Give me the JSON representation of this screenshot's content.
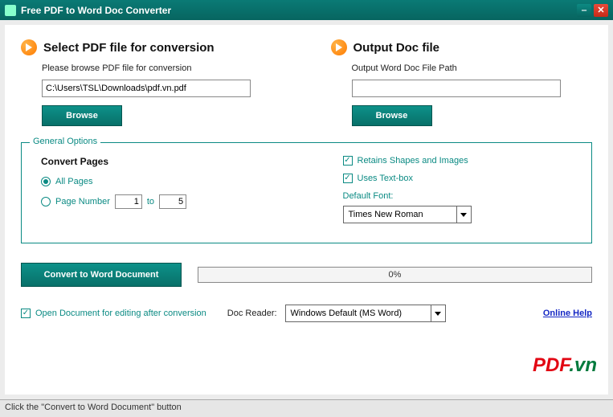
{
  "window": {
    "title": "Free PDF to Word Doc Converter"
  },
  "input_panel": {
    "heading": "Select PDF file for conversion",
    "sub": "Please browse PDF file for conversion",
    "path": "C:\\Users\\TSL\\Downloads\\pdf.vn.pdf",
    "browse": "Browse"
  },
  "output_panel": {
    "heading": "Output Doc file",
    "sub": "Output Word Doc File Path",
    "path": "",
    "browse": "Browse"
  },
  "options": {
    "legend": "General Options",
    "convert_pages_title": "Convert Pages",
    "all_pages": "All Pages",
    "page_number": "Page Number",
    "to": "to",
    "from_value": "1",
    "to_value": "5",
    "retains": "Retains Shapes and Images",
    "textbox": "Uses Text-box",
    "default_font_label": "Default Font:",
    "default_font": "Times New Roman"
  },
  "convert": {
    "button": "Convert to Word Document",
    "progress": "0%"
  },
  "bottom": {
    "open_after": "Open Document for editing after conversion",
    "doc_reader_label": "Doc Reader:",
    "doc_reader": "Windows Default (MS Word)",
    "online_help": "Online Help"
  },
  "statusbar": "Click the \"Convert to Word Document\" button",
  "watermark": {
    "a": "PDF",
    "b": ".vn"
  }
}
